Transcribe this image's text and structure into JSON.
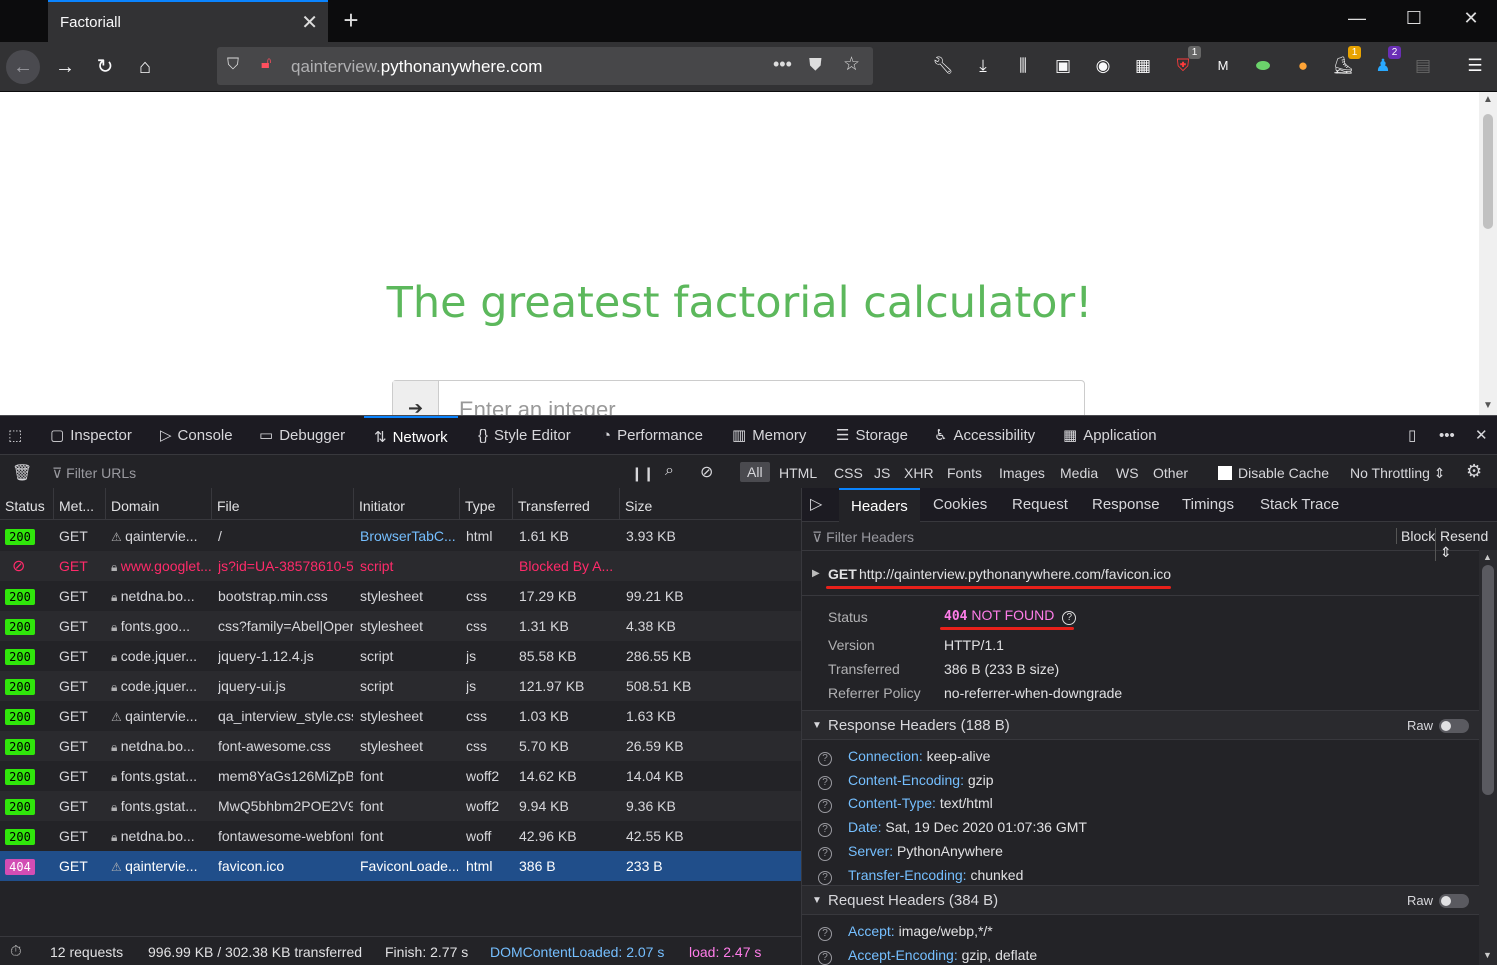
{
  "browser": {
    "tab_title": "Factoriall",
    "url_host_prefix": "qainterview.",
    "url_host_main": "pythonanywhere.com",
    "toolbar_badges": [
      "1",
      "1",
      "2"
    ]
  },
  "page": {
    "heading": "The greatest factorial calculator!",
    "input_placeholder": "Enter an integer"
  },
  "devtools": {
    "tabs": [
      "Inspector",
      "Console",
      "Debugger",
      "Network",
      "Style Editor",
      "Performance",
      "Memory",
      "Storage",
      "Accessibility",
      "Application"
    ],
    "filter_placeholder": "Filter URLs",
    "type_filters": [
      "All",
      "HTML",
      "CSS",
      "JS",
      "XHR",
      "Fonts",
      "Images",
      "Media",
      "WS",
      "Other"
    ],
    "disable_cache_label": "Disable Cache",
    "throttling": "No Throttling",
    "columns": [
      "Status",
      "Met...",
      "Domain",
      "File",
      "Initiator",
      "Type",
      "Transferred",
      "Size"
    ],
    "requests": [
      {
        "status": "200",
        "method": "GET",
        "domain": "qaintervie...",
        "file": "/",
        "initiator": "BrowserTabC...",
        "type": "html",
        "transferred": "1.61 KB",
        "size": "3.93 KB"
      },
      {
        "status": "",
        "method": "GET",
        "domain": "www.googlet...",
        "file": "js?id=UA-38578610-5",
        "initiator": "script",
        "type": "",
        "transferred": "Blocked By A...",
        "size": ""
      },
      {
        "status": "200",
        "method": "GET",
        "domain": "netdna.bo...",
        "file": "bootstrap.min.css",
        "initiator": "stylesheet",
        "type": "css",
        "transferred": "17.29 KB",
        "size": "99.21 KB"
      },
      {
        "status": "200",
        "method": "GET",
        "domain": "fonts.goo...",
        "file": "css?family=Abel|Open",
        "initiator": "stylesheet",
        "type": "css",
        "transferred": "1.31 KB",
        "size": "4.38 KB"
      },
      {
        "status": "200",
        "method": "GET",
        "domain": "code.jquer...",
        "file": "jquery-1.12.4.js",
        "initiator": "script",
        "type": "js",
        "transferred": "85.58 KB",
        "size": "286.55 KB"
      },
      {
        "status": "200",
        "method": "GET",
        "domain": "code.jquer...",
        "file": "jquery-ui.js",
        "initiator": "script",
        "type": "js",
        "transferred": "121.97 KB",
        "size": "508.51 KB"
      },
      {
        "status": "200",
        "method": "GET",
        "domain": "qaintervie...",
        "file": "qa_interview_style.css",
        "initiator": "stylesheet",
        "type": "css",
        "transferred": "1.03 KB",
        "size": "1.63 KB"
      },
      {
        "status": "200",
        "method": "GET",
        "domain": "netdna.bo...",
        "file": "font-awesome.css",
        "initiator": "stylesheet",
        "type": "css",
        "transferred": "5.70 KB",
        "size": "26.59 KB"
      },
      {
        "status": "200",
        "method": "GET",
        "domain": "fonts.gstat...",
        "file": "mem8YaGs126MiZpBA",
        "initiator": "font",
        "type": "woff2",
        "transferred": "14.62 KB",
        "size": "14.04 KB"
      },
      {
        "status": "200",
        "method": "GET",
        "domain": "fonts.gstat...",
        "file": "MwQ5bhbm2POE2V9",
        "initiator": "font",
        "type": "woff2",
        "transferred": "9.94 KB",
        "size": "9.36 KB"
      },
      {
        "status": "200",
        "method": "GET",
        "domain": "netdna.bo...",
        "file": "fontawesome-webfont",
        "initiator": "font",
        "type": "woff",
        "transferred": "42.96 KB",
        "size": "42.55 KB"
      },
      {
        "status": "404",
        "method": "GET",
        "domain": "qaintervie...",
        "file": "favicon.ico",
        "initiator": "FaviconLoade...",
        "type": "html",
        "transferred": "386 B",
        "size": "233 B"
      }
    ],
    "summary": {
      "requests": "12 requests",
      "transferred": "996.99 KB / 302.38 KB transferred",
      "finish": "Finish: 2.77 s",
      "dcl": "DOMContentLoaded: 2.07 s",
      "load": "load: 2.47 s"
    },
    "side_tabs": [
      "Headers",
      "Cookies",
      "Request",
      "Response",
      "Timings",
      "Stack Trace"
    ],
    "filter_headers_placeholder": "Filter Headers",
    "block_label": "Block",
    "resend_label": "Resend",
    "request_line": {
      "method": "GET",
      "url": "http://qainterview.pythonanywhere.com/favicon.ico"
    },
    "general": [
      {
        "key": "Status",
        "value_code": "404",
        "value_text": "NOT FOUND"
      },
      {
        "key": "Version",
        "value": "HTTP/1.1"
      },
      {
        "key": "Transferred",
        "value": "386 B (233 B size)"
      },
      {
        "key": "Referrer Policy",
        "value": "no-referrer-when-downgrade"
      }
    ],
    "response_headers_title": "Response Headers (188 B)",
    "raw_label": "Raw",
    "response_headers": [
      {
        "key": "Connection:",
        "value": "keep-alive"
      },
      {
        "key": "Content-Encoding:",
        "value": "gzip"
      },
      {
        "key": "Content-Type:",
        "value": "text/html"
      },
      {
        "key": "Date:",
        "value": "Sat, 19 Dec 2020 01:07:36 GMT"
      },
      {
        "key": "Server:",
        "value": "PythonAnywhere"
      },
      {
        "key": "Transfer-Encoding:",
        "value": "chunked"
      }
    ],
    "request_headers_title": "Request Headers (384 B)",
    "request_headers": [
      {
        "key": "Accept:",
        "value": "image/webp,*/*"
      },
      {
        "key": "Accept-Encoding:",
        "value": "gzip, deflate"
      }
    ]
  }
}
